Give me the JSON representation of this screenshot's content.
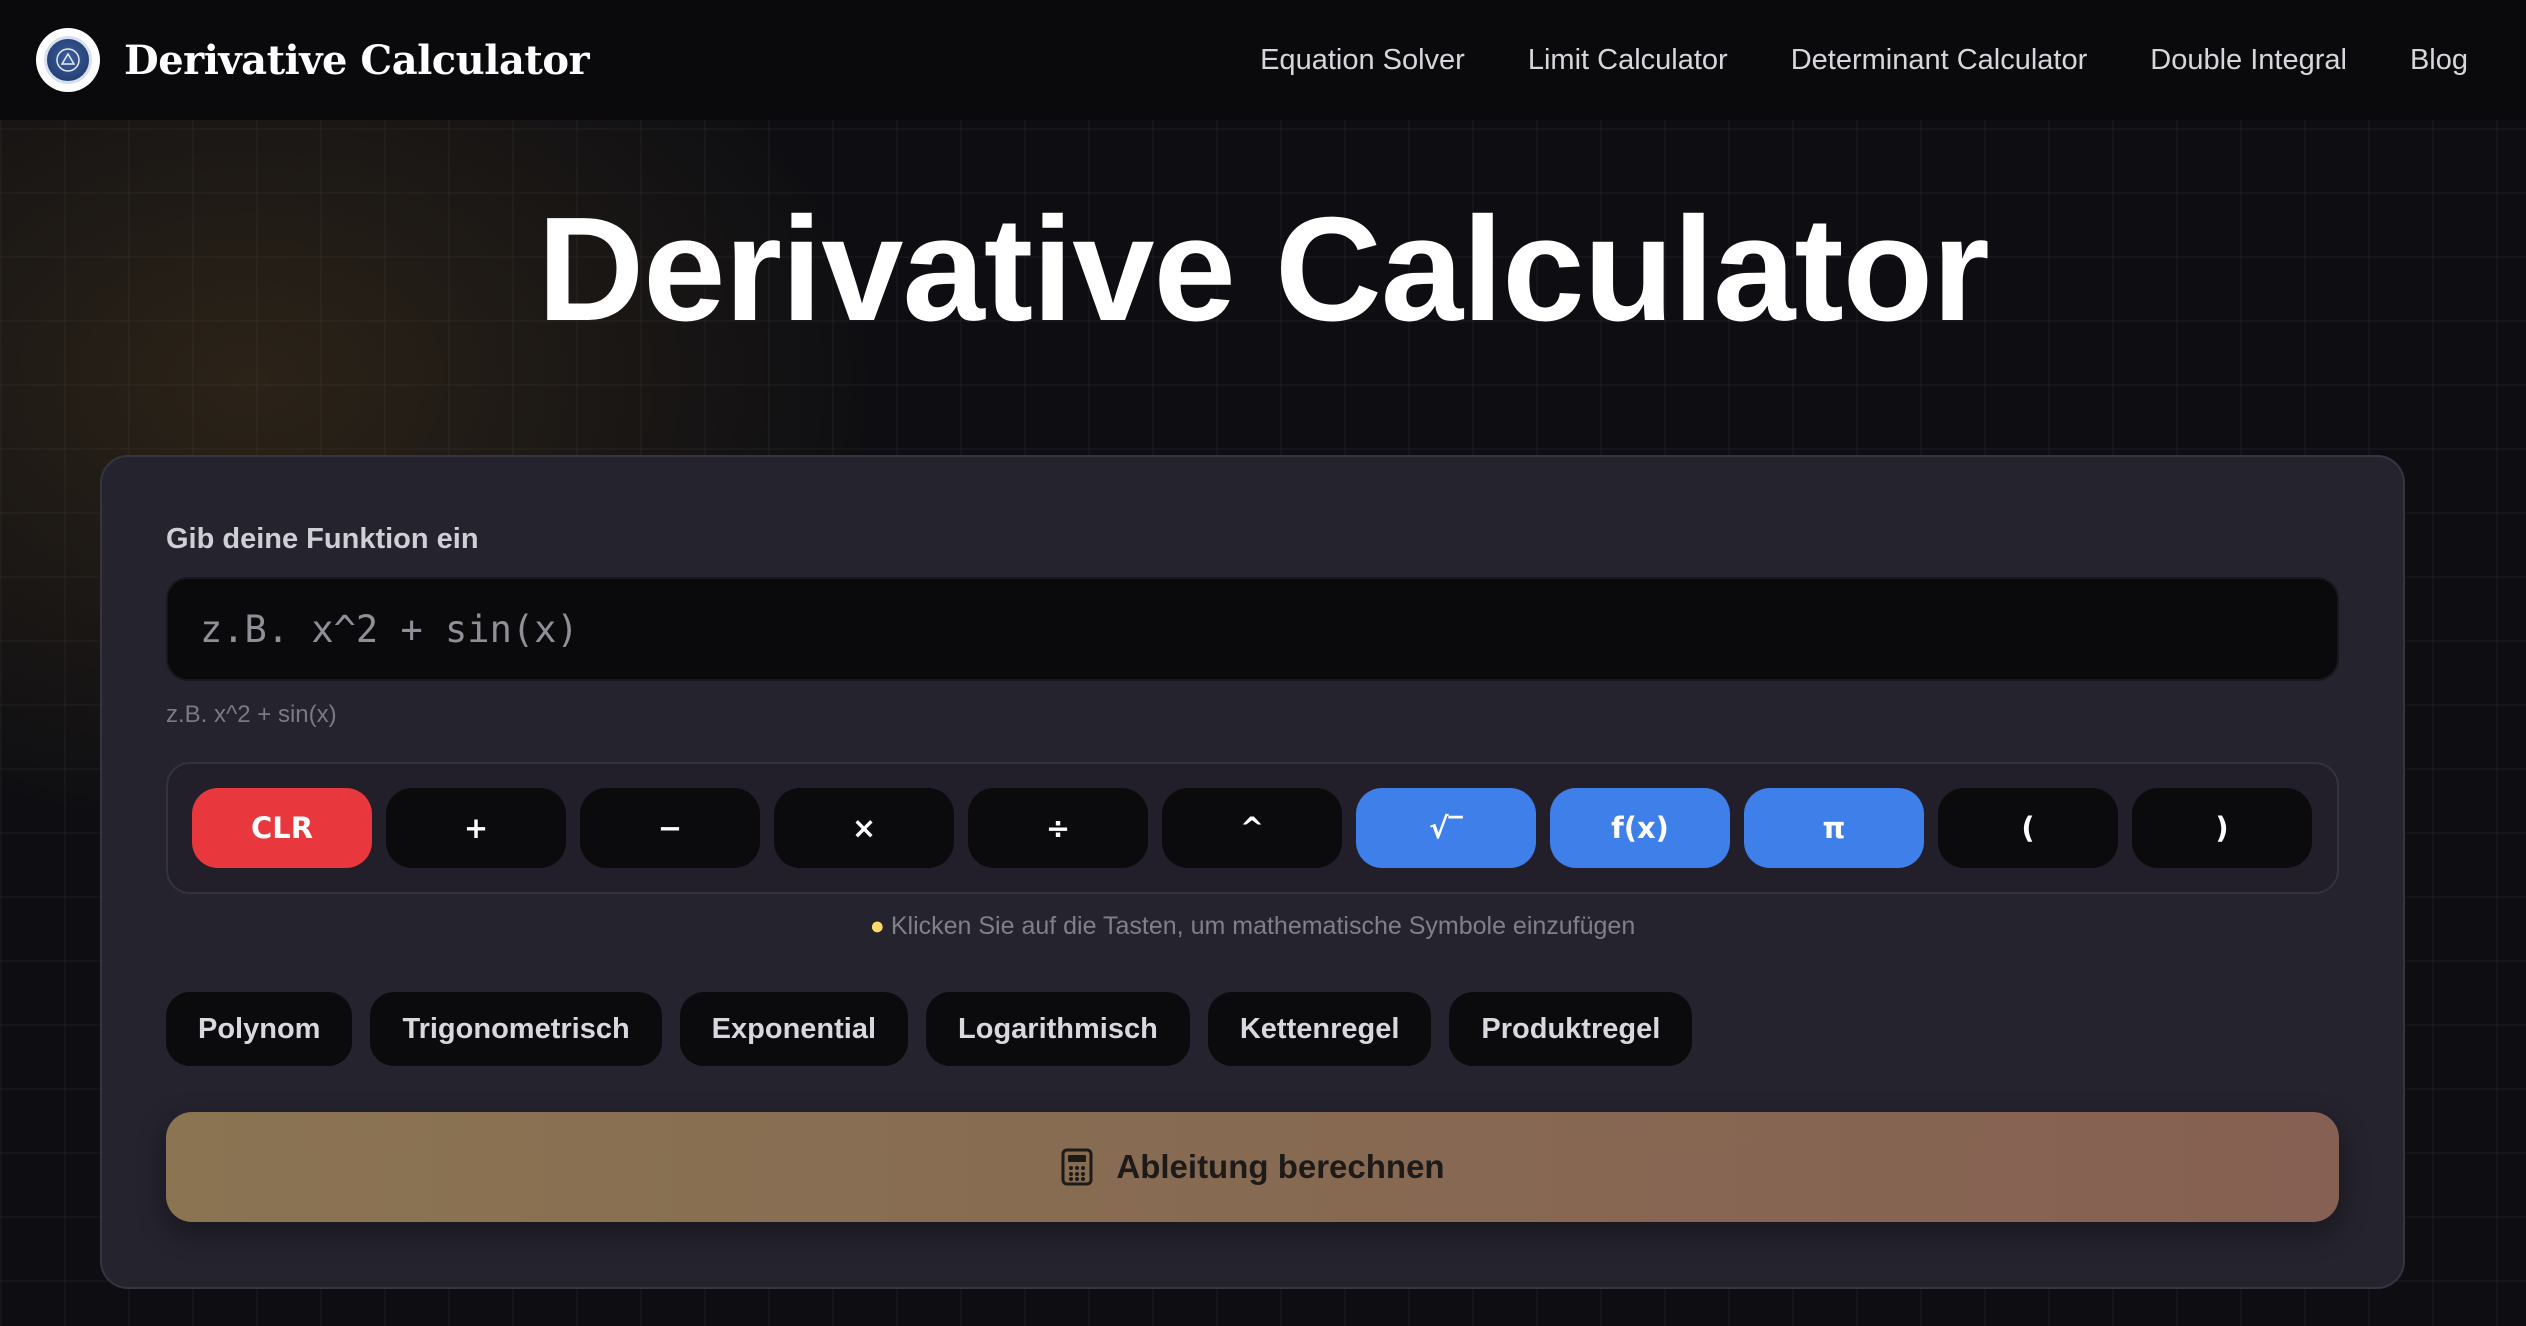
{
  "nav": {
    "brand": "Derivative Calculator",
    "links": [
      "Equation Solver",
      "Limit Calculator",
      "Determinant Calculator",
      "Double Integral",
      "Blog"
    ]
  },
  "hero": {
    "title": "Derivative Calculator"
  },
  "form": {
    "label": "Gib deine Funktion ein",
    "placeholder": "z.B. x^2 + sin(x)",
    "value": "",
    "hint": "z.B. x^2 + sin(x)"
  },
  "keypad": {
    "keys": [
      "CLR",
      "+",
      "−",
      "×",
      "÷",
      "^",
      "√‾",
      "f(x)",
      "π",
      "(",
      ")"
    ],
    "hint": "Klicken Sie auf die Tasten, um mathematische Symbole einzufügen"
  },
  "presets": [
    "Polynom",
    "Trigonometrisch",
    "Exponential",
    "Logarithmisch",
    "Kettenregel",
    "Produktregel"
  ],
  "submit": {
    "label": "Ableitung berechnen"
  },
  "colors": {
    "accent_red": "#e8383d",
    "accent_blue": "#3f7fea",
    "submit_gradient_start": "#8a7452",
    "submit_gradient_end": "#866052"
  },
  "icons": {
    "logo": "logo-seal-icon",
    "calculator": "calculator-icon",
    "hint": "lightbulb-icon"
  }
}
